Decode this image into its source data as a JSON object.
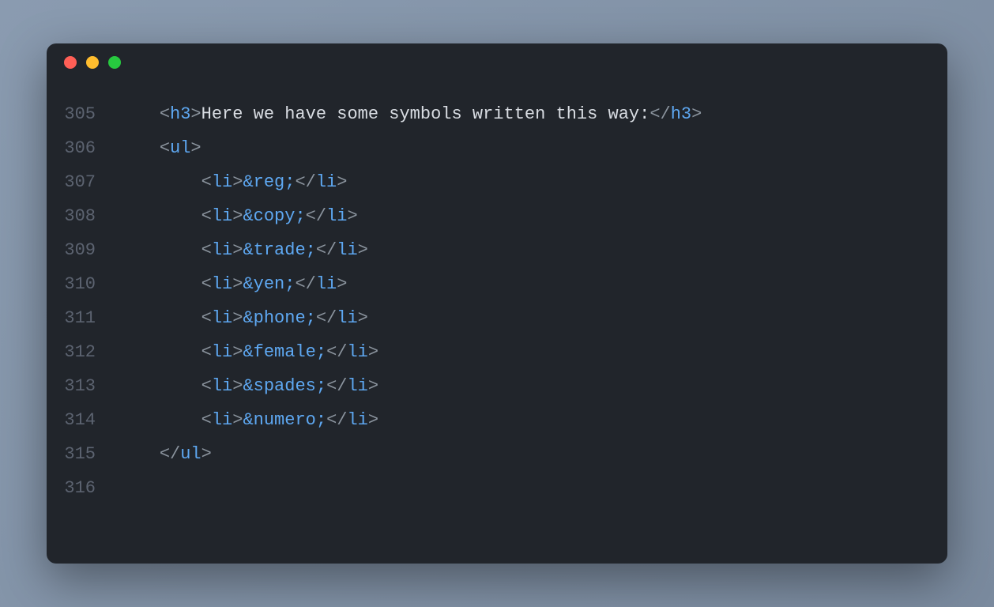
{
  "colors": {
    "background_page": "#8a9bb0",
    "background_editor": "#21252b",
    "line_number": "#5c6370",
    "bracket": "#8b949e",
    "tag": "#5ea8f2",
    "text": "#d9dde3",
    "traffic_red": "#ff5f56",
    "traffic_yellow": "#ffbd2e",
    "traffic_green": "#27c93f"
  },
  "line_numbers": [
    "305",
    "306",
    "307",
    "308",
    "309",
    "310",
    "311",
    "312",
    "313",
    "314",
    "315",
    "316"
  ],
  "tags": {
    "h3": "h3",
    "ul": "ul",
    "li": "li"
  },
  "brackets": {
    "open": "<",
    "close": ">",
    "open_end": "</"
  },
  "h3_text": "Here we have some symbols written this way:",
  "entities": [
    "&reg;",
    "&copy;",
    "&trade;",
    "&yen;",
    "&phone;",
    "&female;",
    "&spades;",
    "&numero;"
  ],
  "indent": {
    "level1": "    ",
    "level2": "        "
  }
}
